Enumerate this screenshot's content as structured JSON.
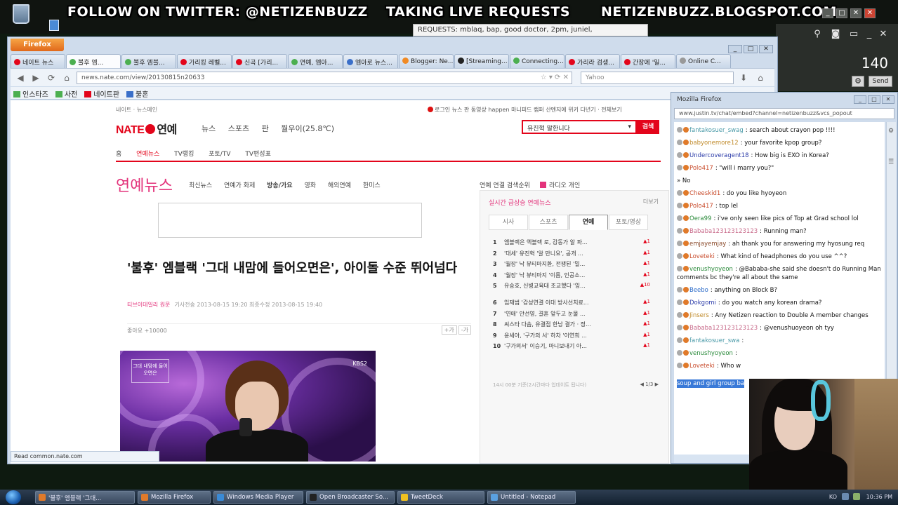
{
  "overlay": {
    "twitter": "FOLLOW ON TWITTER: @NETIZENBUZZ",
    "live": "TAKING LIVE REQUESTS",
    "blog": "NETIZENBUZZ.BLOGSPOT.COM",
    "requests": "REQUESTS: mblaq, bap, good doctor, 2pm, juniel,"
  },
  "broadcast_panel": {
    "counter": "140",
    "send_label": "Send"
  },
  "firefox": {
    "menu_label": "Firefox",
    "tabs": [
      {
        "label": "네이트 뉴스",
        "color": "#e3051b"
      },
      {
        "label": "불후 엠...",
        "color": "#4caf50",
        "active": true
      },
      {
        "label": "불후 엠블...",
        "color": "#4caf50"
      },
      {
        "label": "가리킹 레벨...",
        "color": "#e3051b"
      },
      {
        "label": "신곡 [가리...",
        "color": "#e3051b"
      },
      {
        "label": "연예, 엠아...",
        "color": "#4caf50"
      },
      {
        "label": "엠아로 뉴스...",
        "color": "#3a6fc9"
      },
      {
        "label": "Blogger: Ne...",
        "color": "#f08a24"
      },
      {
        "label": "[Streaming...",
        "color": "#222222"
      },
      {
        "label": "Connecting...",
        "color": "#4caf50"
      },
      {
        "label": "가리라 검생...",
        "color": "#e3051b"
      },
      {
        "label": "간장에 '일...",
        "color": "#e3051b"
      },
      {
        "label": "Online C...",
        "color": "#999999"
      }
    ],
    "url": "news.nate.com/view/20130815n20633",
    "search_placeholder": "Yahoo",
    "bookmarks": [
      {
        "label": "인스타즈",
        "color": "#4caf50"
      },
      {
        "label": "사전",
        "color": "#4caf50"
      },
      {
        "label": "네이트판",
        "color": "#e3051b"
      },
      {
        "label": "불혼",
        "color": "#3a6fc9"
      }
    ],
    "status": "Read common.nate.com"
  },
  "nate": {
    "util_links": "네이트 · 뉴스메인",
    "util_right": "로그인  뉴스 판 동영상 happen 마니피드 캠퍼 산멘지에 위키 다년기  · 전체보기",
    "logo_brand": "NATE",
    "logo_ent": "연예",
    "gnb": [
      "뉴스",
      "스포츠",
      "판",
      "월우이(25.8℃)"
    ],
    "search_value": "유진혁 말한니다",
    "search_button": "검색",
    "subnav": [
      "홈",
      "연예뉴스",
      "TV랭킹",
      "포토/TV",
      "TV편성표"
    ],
    "section_title": "연예뉴스",
    "section_menu": [
      "최신뉴스",
      "연예가 화제",
      "방송/가요",
      "영화",
      "해외연예",
      "한미스"
    ],
    "section_right": "연예 연결 검색순위",
    "section_right2": "라디오 개인",
    "headline": "'불후' 엠블랙 '그대 내맘에 들어오면은', 아이돌 수준 뛰어넘다",
    "byline_source": "티브이데일리 원문",
    "byline_time": "기사전송 2013-08-15 19:20   최종수정 2013-08-15 19:40",
    "share_label": "좋아요 +10000",
    "fontsize": [
      "+가",
      "-가"
    ],
    "photo_caption": "그대 내맘에 들어오면은",
    "photo_logo": "KBS2"
  },
  "ranking": {
    "title": "실시간 급상승 연예뉴스",
    "more": "더보기",
    "tabs": [
      "시사",
      "스포츠",
      "연예",
      "포토/영상"
    ],
    "active_tab": 2,
    "items": [
      {
        "num": "1",
        "text": "엠블랙은 엑블랙 로, 감동가 알 파...",
        "chg": "▲1"
      },
      {
        "num": "2",
        "text": "'대세' 유진혁 '알 만니요', 공개 ...",
        "chg": "▲1"
      },
      {
        "num": "3",
        "text": "'월장' 낙 뷰티마지환, 전쟁된 '밀...",
        "chg": "▲1"
      },
      {
        "num": "4",
        "text": "'월장' 낙 뷰티마지 '이름, 인공소...",
        "chg": "▲1"
      },
      {
        "num": "5",
        "text": "유승호, 신병교육대 조교했다 '잉...",
        "chg": "▲10"
      },
      {
        "num": "6",
        "text": "임재범 '감성연결 이대 방사선치료...",
        "chg": "▲1"
      },
      {
        "num": "7",
        "text": "'연애' 안선영, 결혼 앞두고 눈물 ...",
        "chg": "▲1"
      },
      {
        "num": "8",
        "text": "씨스타 다솜, 유결점 한남 결가 · 정...",
        "chg": "▲1"
      },
      {
        "num": "9",
        "text": "윤세아, '구가의 서' 하차 '이연희 ...",
        "chg": "▲1"
      },
      {
        "num": "10",
        "text": "'구가의서' 이승기, 마니보내기 아...",
        "chg": "▲1"
      }
    ],
    "footer": "14시 00분 기준(2시간마다 업데이트 됩니다)",
    "page": "1/3"
  },
  "chat": {
    "window_title": "Mozilla Firefox",
    "url": "www.justin.tv/chat/embed?channel=netizenbuzz&vcs_popout",
    "messages": [
      {
        "user": "fantakosuer_swag",
        "text": "search about crayon pop !!!!",
        "color": "#4a9aa8"
      },
      {
        "user": "babyonemore12",
        "text": "your favorite kpop group?",
        "color": "#c08a2a"
      },
      {
        "user": "Undercoveragent18",
        "text": "How big is EXO in Korea?",
        "color": "#2a3aa8"
      },
      {
        "user": "Polo417",
        "text": "\"will i marry you?\"",
        "color": "#c84a2a"
      },
      {
        "user": "",
        "text": "» No",
        "color": "#111111"
      },
      {
        "user": "Cheeskid1",
        "text": "do you like hyoyeon",
        "color": "#c84a2a"
      },
      {
        "user": "Polo417",
        "text": "top lel",
        "color": "#c84a2a"
      },
      {
        "user": "Oera99",
        "text": "i've only seen like pics of Top at Grad school lol",
        "color": "#2a8a3a"
      },
      {
        "user": "Bababa123123123123",
        "text": "Running man?",
        "color": "#c86a8a"
      },
      {
        "user": "emjayemjay",
        "text": "ah thank you for answering my hyosung req",
        "color": "#8a4a2a"
      },
      {
        "user": "Loveteki",
        "text": "What kind of headphones do you use ^^?",
        "color": "#c84a2a"
      },
      {
        "user": "venushyoyeon",
        "text": "@Bababa-she said she doesn't do Running Man comments bc they're all about the same",
        "color": "#2a8a3a"
      },
      {
        "user": "Beebo",
        "text": "anything on Block B?",
        "color": "#2a6ac8"
      },
      {
        "user": "Dokgomi",
        "text": "do you watch any korean drama?",
        "color": "#2a3aa8"
      },
      {
        "user": "Jinsers",
        "text": "Any Netizen reaction to Double A member changes",
        "color": "#c08a2a"
      },
      {
        "user": "Bababa123123123123",
        "text": "@venushuoyeon oh tyy",
        "color": "#c86a8a"
      },
      {
        "user": "fantakosuer_swa",
        "text": "",
        "color": "#4a9aa8"
      },
      {
        "user": "venushyoyeon",
        "text": "",
        "color": "#2a8a3a"
      },
      {
        "user": "Loveteki",
        "text": "Who w",
        "color": "#c84a2a"
      }
    ],
    "highlight": "soup and girl group ba"
  },
  "taskbar": {
    "tasks": [
      {
        "label": "'불후' 엠블랙 '그대...",
        "color": "#e07a2a"
      },
      {
        "label": "Mozilla Firefox",
        "color": "#e07a2a"
      },
      {
        "label": "Windows Media Player",
        "color": "#3a8ad6"
      },
      {
        "label": "Open Broadcaster So...",
        "color": "#222222"
      },
      {
        "label": "TweetDeck",
        "color": "#f0c020"
      },
      {
        "label": "Untitled - Notepad",
        "color": "#5aa0e0"
      }
    ],
    "tray_lang": "KO",
    "clock": "10:36 PM"
  }
}
